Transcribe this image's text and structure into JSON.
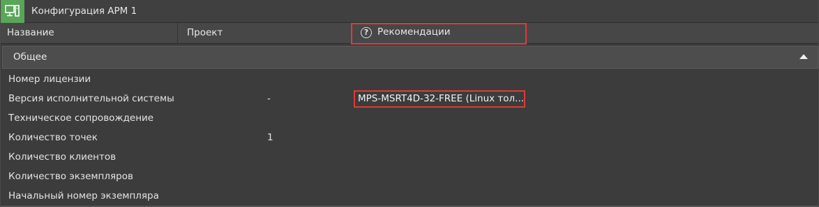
{
  "window": {
    "title": "Конфигурация АРМ 1",
    "icon": "workstation-icon",
    "accent_color": "#5aa55a"
  },
  "columns": {
    "name": "Название",
    "project": "Проект",
    "recommendations": "Рекомендации",
    "recommendations_icon": "help-icon",
    "recommendations_icon_glyph": "?"
  },
  "group": {
    "label": "Общее",
    "expanded": true
  },
  "rows": [
    {
      "name": "Номер лицензии",
      "project": "",
      "recommendation": ""
    },
    {
      "name": "Версия исполнительной системы",
      "project": "-",
      "recommendation": "MPS-MSRT4D-32-FREE (Linux тол..."
    },
    {
      "name": "Техническое сопровождение",
      "project": "",
      "recommendation": ""
    },
    {
      "name": "Количество точек",
      "project": "1",
      "recommendation": ""
    },
    {
      "name": "Количество клиентов",
      "project": "",
      "recommendation": ""
    },
    {
      "name": "Количество экземпляров",
      "project": "",
      "recommendation": ""
    },
    {
      "name": "Начальный номер экземпляра",
      "project": "",
      "recommendation": ""
    }
  ],
  "highlight_color": "#e03a3a"
}
